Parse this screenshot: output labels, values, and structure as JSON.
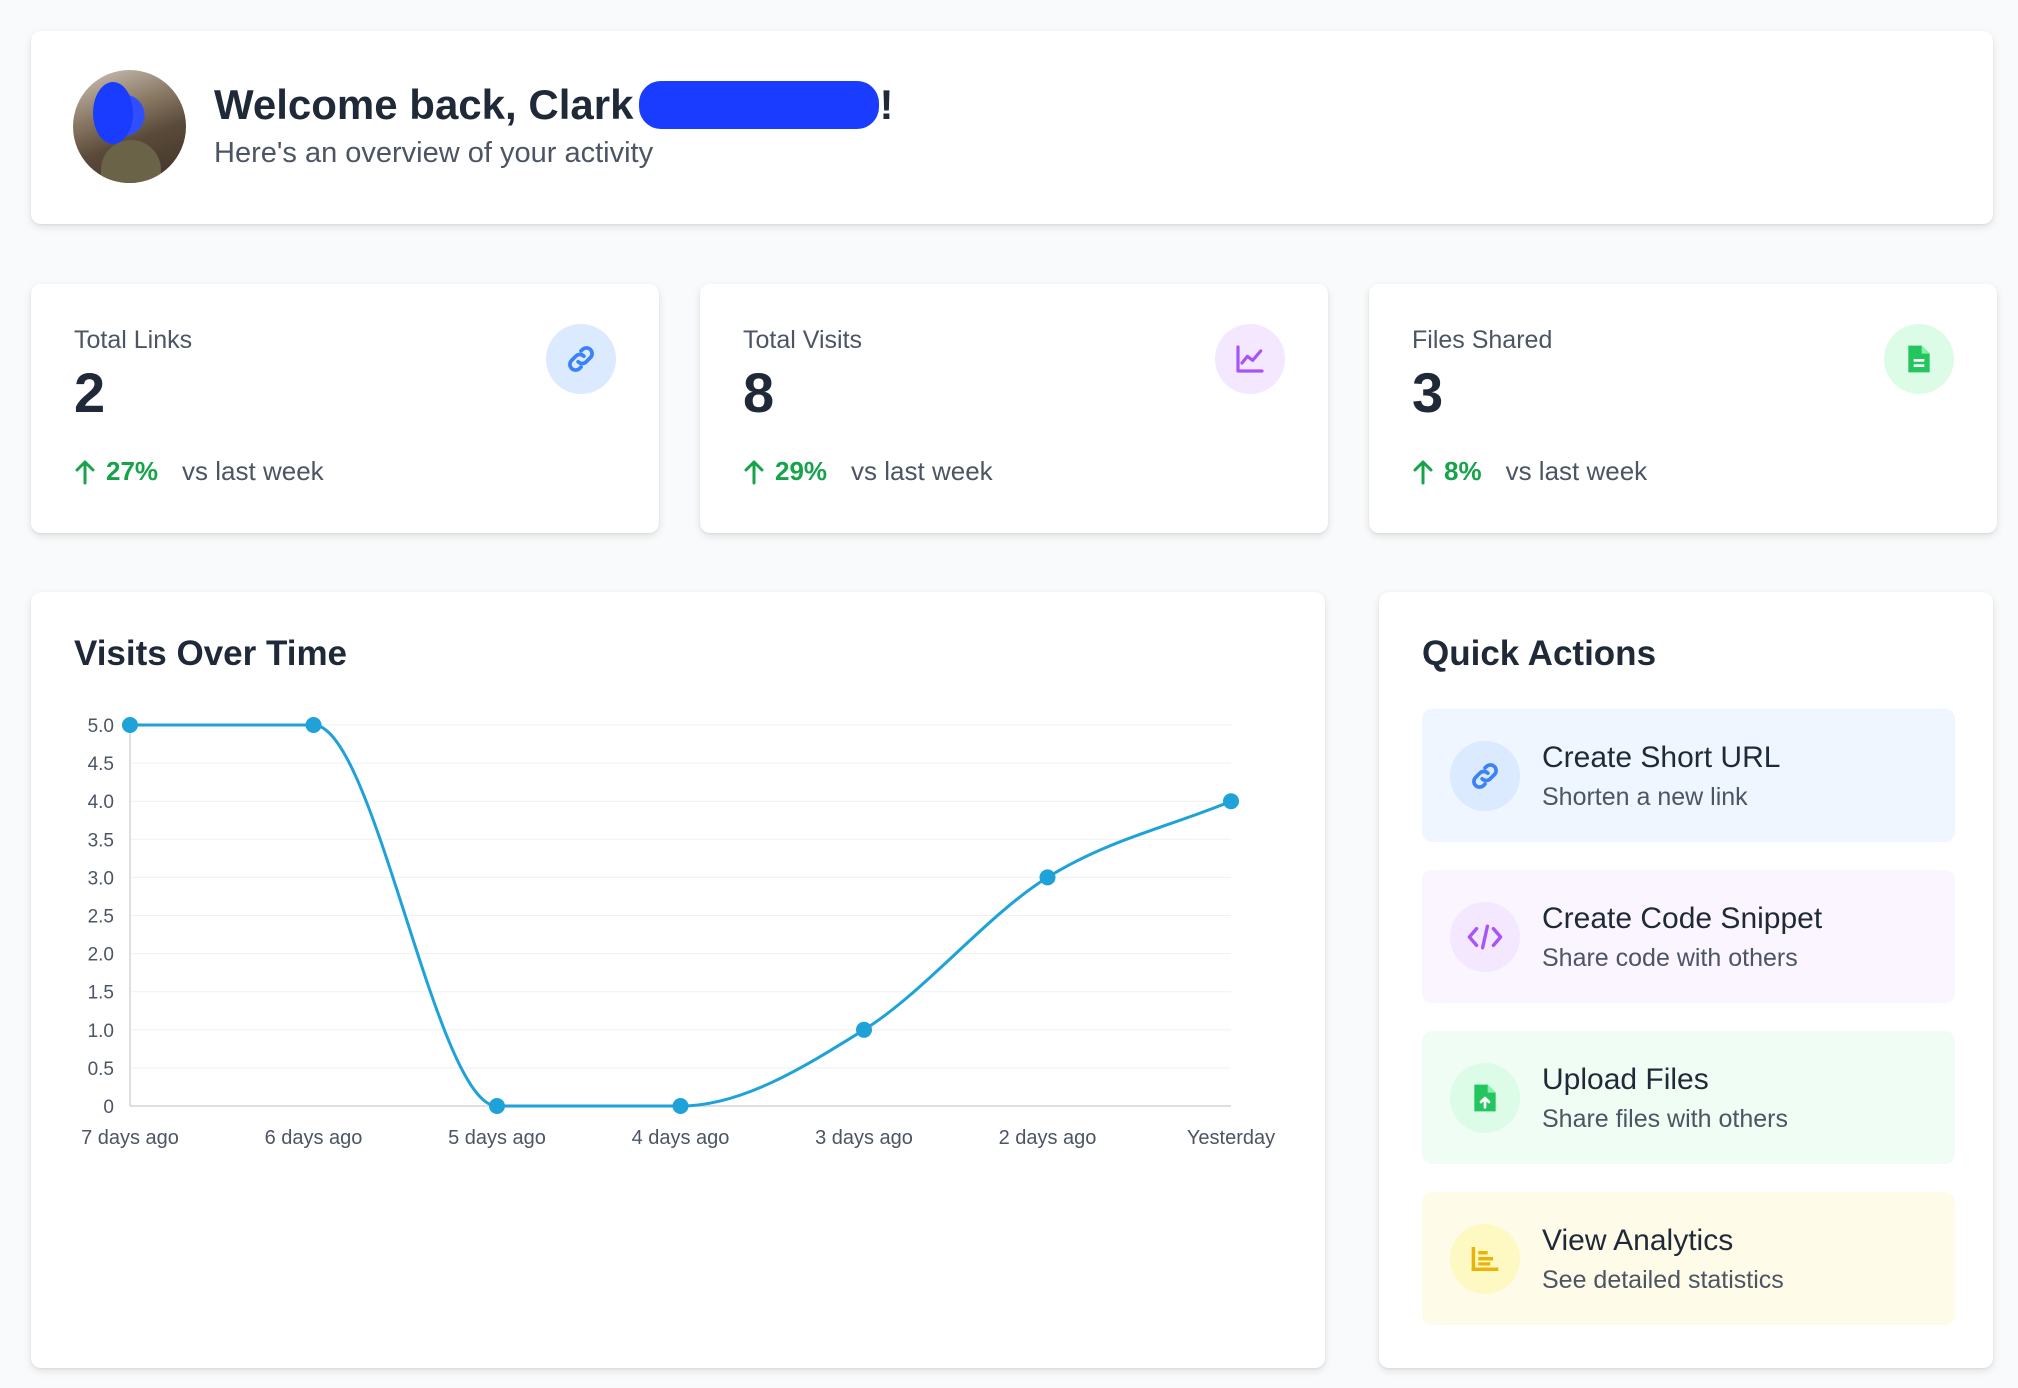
{
  "welcome": {
    "title": "Welcome back, Clark",
    "exclaim": "!",
    "subtitle": "Here's an overview of your activity"
  },
  "stats": [
    {
      "label": "Total Links",
      "value": "2",
      "change": "27%",
      "vs": "vs last week",
      "icon": "link-icon",
      "icon_color": "#3b82f6",
      "icon_bg": "#dbeafe"
    },
    {
      "label": "Total Visits",
      "value": "8",
      "change": "29%",
      "vs": "vs last week",
      "icon": "chart-line-icon",
      "icon_color": "#a855f7",
      "icon_bg": "#f3e8ff"
    },
    {
      "label": "Files Shared",
      "value": "3",
      "change": "8%",
      "vs": "vs last week",
      "icon": "file-icon",
      "icon_color": "#22c55e",
      "icon_bg": "#dcfce7"
    }
  ],
  "visits_chart": {
    "title": "Visits Over Time"
  },
  "chart_data": {
    "type": "line",
    "categories": [
      "7 days ago",
      "6 days ago",
      "5 days ago",
      "4 days ago",
      "3 days ago",
      "2 days ago",
      "Yesterday"
    ],
    "series": [
      {
        "values": [
          5,
          5,
          0,
          0,
          1,
          3,
          4
        ]
      }
    ],
    "title": "Visits Over Time",
    "xlabel": "",
    "ylabel": "",
    "ylim": [
      0,
      5
    ],
    "yticks": [
      "0",
      "0.5",
      "1.0",
      "1.5",
      "2.0",
      "2.5",
      "3.0",
      "3.5",
      "4.0",
      "4.5",
      "5.0"
    ],
    "grid": true,
    "color": "#1ea2d8"
  },
  "quick_actions": {
    "title": "Quick Actions",
    "items": [
      {
        "title": "Create Short URL",
        "desc": "Shorten a new link",
        "icon": "link-icon",
        "bg": "#eff6ff",
        "icon_bg": "#dbeafe",
        "icon_color": "#3b82f6"
      },
      {
        "title": "Create Code Snippet",
        "desc": "Share code with others",
        "icon": "code-icon",
        "bg": "#faf5ff",
        "icon_bg": "#f3e8ff",
        "icon_color": "#a855f7"
      },
      {
        "title": "Upload Files",
        "desc": "Share files with others",
        "icon": "file-upload-icon",
        "bg": "#f0fdf4",
        "icon_bg": "#dcfce7",
        "icon_color": "#22c55e"
      },
      {
        "title": "View Analytics",
        "desc": "See detailed statistics",
        "icon": "chart-bar-icon",
        "bg": "#fefce8",
        "icon_bg": "#fef9c3",
        "icon_color": "#eab308"
      }
    ]
  }
}
